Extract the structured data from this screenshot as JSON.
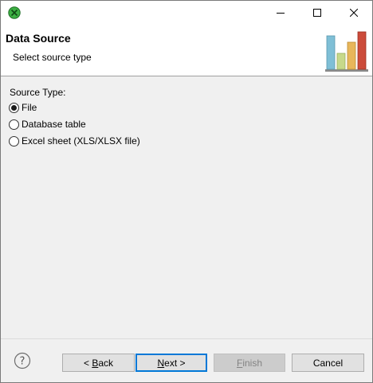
{
  "window": {
    "title_buttons": {
      "minimize": "minimize-icon",
      "maximize": "maximize-icon",
      "close": "close-icon"
    }
  },
  "header": {
    "title": "Data Source",
    "subtitle": "Select source type"
  },
  "source": {
    "label": "Source Type:",
    "options": [
      {
        "label": "File",
        "selected": true
      },
      {
        "label": "Database table",
        "selected": false
      },
      {
        "label": "Excel sheet (XLS/XLSX file)",
        "selected": false
      }
    ]
  },
  "footer": {
    "back_prefix": "< ",
    "back_key": "B",
    "back_rest": "ack",
    "next_key": "N",
    "next_rest": "ext >",
    "finish_key": "F",
    "finish_rest": "inish",
    "cancel": "Cancel"
  },
  "colors": {
    "accent": "#0078d7",
    "bar_blue": "#7fbfd6",
    "bar_green": "#c7d98a",
    "bar_orange": "#e8b65a",
    "bar_red": "#cc4b3a"
  }
}
